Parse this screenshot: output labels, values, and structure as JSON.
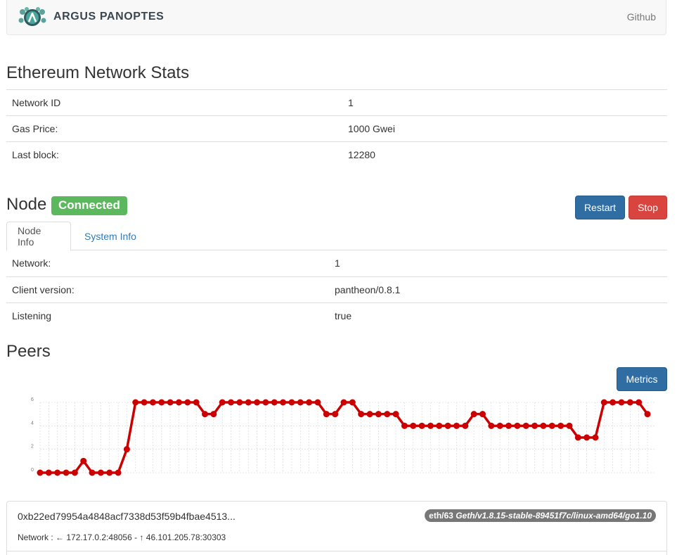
{
  "navbar": {
    "brand": "ARGUS PANOPTES",
    "github": "Github"
  },
  "network_stats": {
    "title": "Ethereum Network Stats",
    "rows": [
      {
        "label": "Network ID",
        "value": "1"
      },
      {
        "label": "Gas Price:",
        "value": "1000 Gwei"
      },
      {
        "label": "Last block:",
        "value": "12280"
      }
    ]
  },
  "node": {
    "title": "Node",
    "status": "Connected",
    "restart_label": "Restart",
    "stop_label": "Stop",
    "tabs": [
      {
        "label": "Node Info",
        "active": true
      },
      {
        "label": "System Info",
        "active": false
      }
    ],
    "rows": [
      {
        "label": "Network:",
        "value": "1"
      },
      {
        "label": "Client version:",
        "value": "pantheon/0.8.1"
      },
      {
        "label": "Listening",
        "value": "true"
      }
    ]
  },
  "peers": {
    "title": "Peers",
    "metrics_label": "Metrics",
    "list": [
      {
        "id": "0xb22ed79954a4848acf7338d53f59b4fbae4513...",
        "protocol": "eth/63",
        "client": "Geth/v1.8.15-stable-89451f7c/linux-amd64/go1.10",
        "network": "Network : ← 172.17.0.2:48056 - ↑ 46.101.205.78:30303"
      }
    ]
  },
  "chart_data": {
    "type": "line",
    "ylim": [
      0,
      6
    ],
    "y_ticks": [
      "0",
      "2",
      "4",
      "6"
    ],
    "grid": true,
    "series": [
      {
        "color": "#cc0000",
        "values": [
          0,
          0,
          0,
          0,
          0,
          1,
          0,
          0,
          0,
          0,
          2,
          6,
          6,
          6,
          6,
          6,
          6,
          6,
          6,
          5,
          5,
          6,
          6,
          6,
          6,
          6,
          6,
          6,
          6,
          6,
          6,
          6,
          6,
          5,
          5,
          6,
          6,
          5,
          5,
          5,
          5,
          5,
          4,
          4,
          4,
          4,
          4,
          4,
          4,
          4,
          5,
          5,
          4,
          4,
          4,
          4,
          4,
          4,
          4,
          4,
          4,
          4,
          3,
          3,
          3,
          6,
          6,
          6,
          6,
          6,
          5
        ]
      }
    ]
  },
  "colors": {
    "success": "#5cb85c",
    "primary": "#2f6da3",
    "danger": "#d9443f",
    "line": "#cc0000"
  }
}
